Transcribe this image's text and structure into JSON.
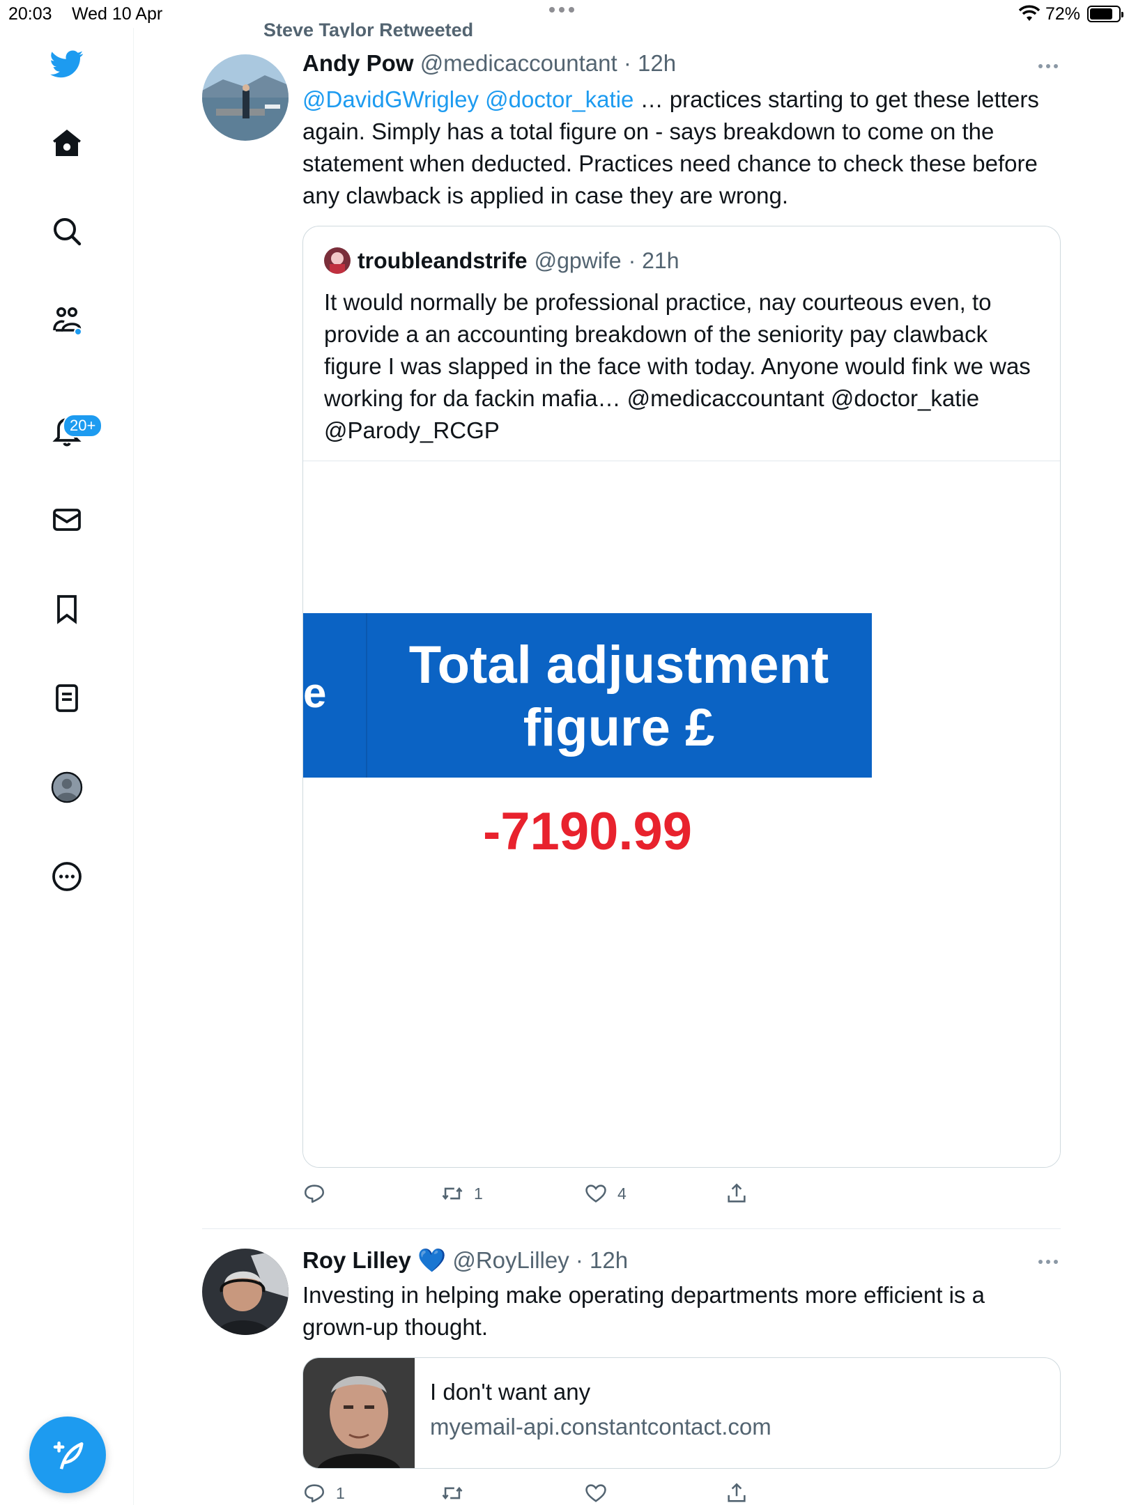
{
  "status_bar": {
    "time": "20:03",
    "date": "Wed 10 Apr",
    "battery": "72%"
  },
  "nav": {
    "notifications_badge": "20+"
  },
  "tweets": [
    {
      "retweet_note": "Steve Taylor Retweeted",
      "name": "Andy Pow",
      "handle": "@medicaccountant",
      "time": "· 12h",
      "mentions": "@DavidGWrigley @doctor_katie",
      "text": "… practices starting to get these letters again. Simply has a total figure on - says breakdown to come on the statement when deducted. Practices need chance to check these before any clawback is applied in case they are wrong.",
      "quote": {
        "name": "troubleandstrife",
        "handle": "@gpwife",
        "time": "· 21h",
        "text": "It would normally be professional practice, nay courteous even, to provide a an accounting breakdown of the seniority pay clawback figure I was slapped in the face with today. Anyone would fink we was working for da fackin mafia… @medicaccountant @doctor_katie @Parody_RCGP",
        "image": {
          "edge_letter": "e",
          "heading_line1": "Total adjustment",
          "heading_line2": "figure £",
          "value": "-7190.99"
        }
      },
      "retweets": "1",
      "likes": "4"
    },
    {
      "name": "Roy Lilley",
      "badge_emoji": "💙",
      "handle": "@RoyLilley",
      "time": "· 12h",
      "text": "Investing in helping make operating departments more efficient is a grown-up thought.",
      "link_card": {
        "title": "I don't want any",
        "domain": "myemail-api.constantcontact.com"
      },
      "replies": "1"
    }
  ]
}
